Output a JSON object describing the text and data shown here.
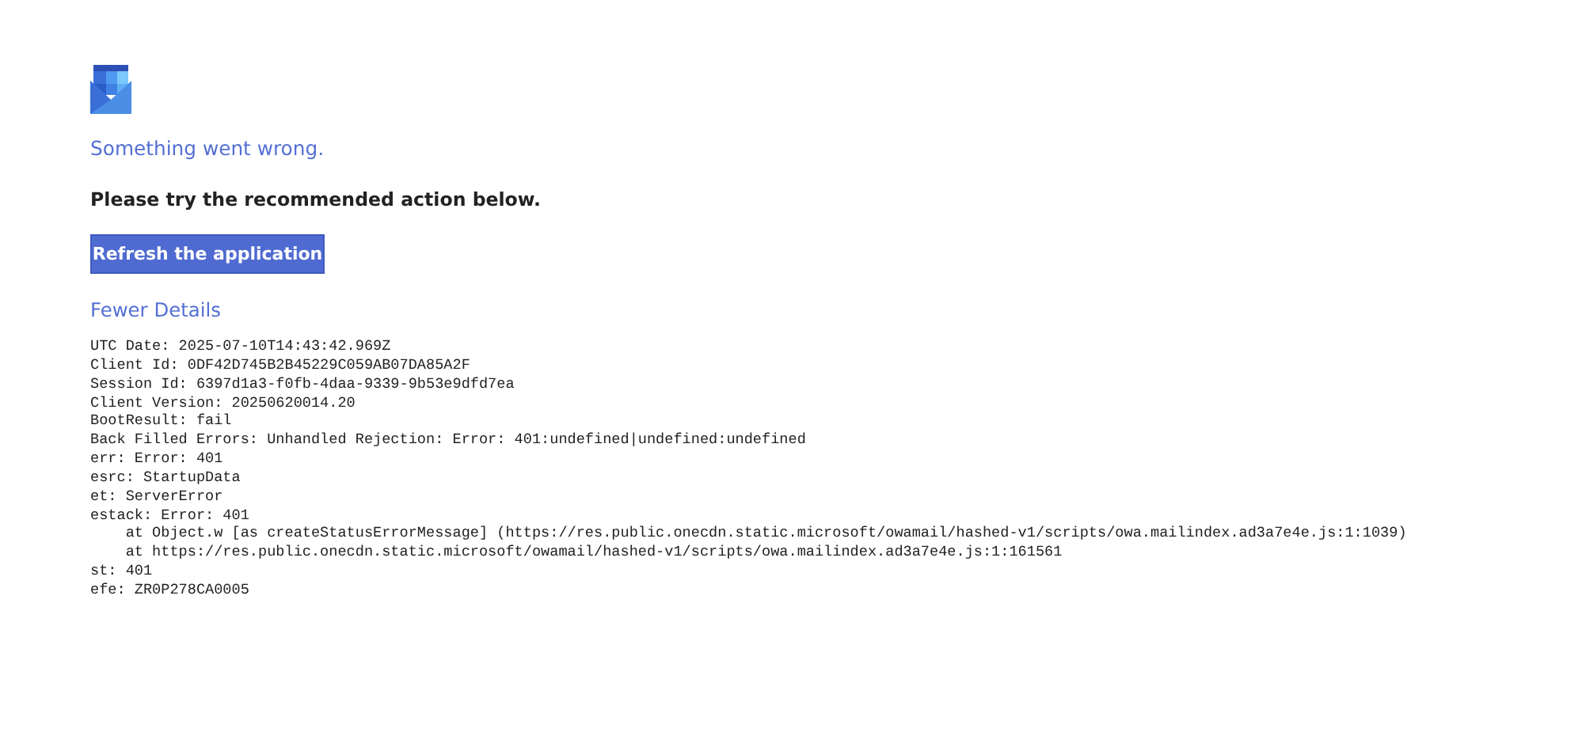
{
  "title": "Something went wrong.",
  "message": "Please try the recommended action below.",
  "action_button": "Refresh the application",
  "details_toggle": "Fewer Details",
  "details": [
    "UTC Date: 2025-07-10T14:43:42.969Z",
    "Client Id: 0DF42D745B2B45229C059AB07DA85A2F",
    "Session Id: 6397d1a3-f0fb-4daa-9339-9b53e9dfd7ea",
    "Client Version: 20250620014.20",
    "BootResult: fail",
    "Back Filled Errors: Unhandled Rejection: Error: 401:undefined|undefined:undefined",
    "err: Error: 401",
    "esrc: StartupData",
    "et: ServerError",
    "estack: Error: 401",
    "    at Object.w [as createStatusErrorMessage] (https://res.public.onecdn.static.microsoft/owamail/hashed-v1/scripts/owa.mailindex.ad3a7e4e.js:1:1039)",
    "    at https://res.public.onecdn.static.microsoft/owamail/hashed-v1/scripts/owa.mailindex.ad3a7e4e.js:1:161561",
    "st: 401",
    "efe: ZR0P278CA0005"
  ]
}
